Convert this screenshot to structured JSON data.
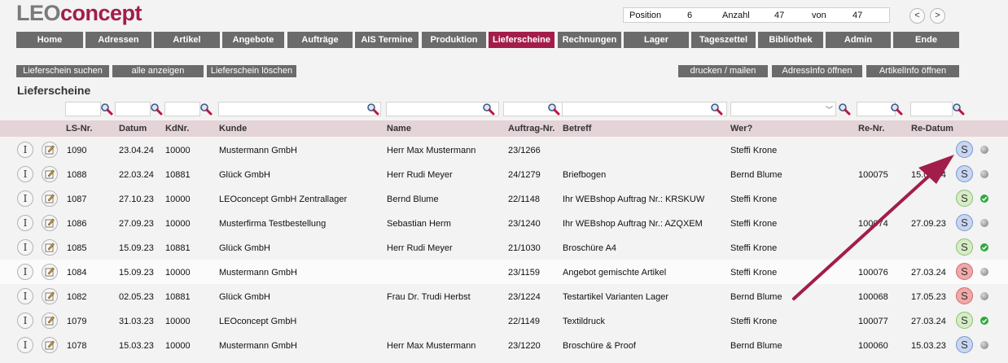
{
  "logo": {
    "part1": "LEO",
    "part2": "concept"
  },
  "position_bar": {
    "position_label": "Position",
    "position_value": "6",
    "count_label": "Anzahl",
    "count_value": "47",
    "of_label": "von",
    "of_value": "47",
    "prev": "<",
    "next": ">"
  },
  "nav": [
    "Home",
    "Adressen",
    "Artikel",
    "Angebote",
    "Aufträge",
    "AIS Termine",
    "Produktion",
    "Lieferscheine",
    "Rechnungen",
    "Lager",
    "Tageszettel",
    "Bibliothek",
    "Admin",
    "Ende"
  ],
  "nav_active": "Lieferscheine",
  "actions": {
    "search": "Lieferschein suchen",
    "show_all": "alle anzeigen",
    "delete": "Lieferschein löschen",
    "print": "drucken / mailen",
    "address_info": "AdressInfo öffnen",
    "article_info": "ArtikelInfo öffnen"
  },
  "page_title": "Lieferscheine",
  "columns": [
    "LS-Nr.",
    "Datum",
    "KdNr.",
    "Kunde",
    "Name",
    "Auftrag-Nr.",
    "Betreff",
    "Wer?",
    "Re-Nr.",
    "Re-Datum"
  ],
  "rows": [
    {
      "ls": "1090",
      "datum": "23.04.24",
      "kd": "10000",
      "kunde": "Mustermann GmbH",
      "name": "Herr Max Mustermann",
      "auftrag": "23/1266",
      "betreff": "",
      "wer": "Steffi Krone",
      "renr": "",
      "redatum": "",
      "status": "blue",
      "dot": "grey"
    },
    {
      "ls": "1088",
      "datum": "22.03.24",
      "kd": "10881",
      "kunde": "Glück GmbH",
      "name": "Herr Rudi Meyer",
      "auftrag": "24/1279",
      "betreff": "Briefbogen",
      "wer": "Bernd Blume",
      "renr": "100075",
      "redatum": "15.03.24",
      "status": "blue",
      "dot": "grey"
    },
    {
      "ls": "1087",
      "datum": "27.10.23",
      "kd": "10000",
      "kunde": "LEOconcept GmbH Zentrallager",
      "name": "Bernd Blume",
      "auftrag": "22/1148",
      "betreff": "Ihr WEBshop Auftrag Nr.: KRSKUW",
      "wer": "Steffi Krone",
      "renr": "",
      "redatum": "",
      "status": "green",
      "dot": "green"
    },
    {
      "ls": "1086",
      "datum": "27.09.23",
      "kd": "10000",
      "kunde": "Musterfirma Testbestellung",
      "name": "Sebastian Herm",
      "auftrag": "23/1240",
      "betreff": "Ihr WEBshop Auftrag Nr.: AZQXEM",
      "wer": "Steffi Krone",
      "renr": "100074",
      "redatum": "27.09.23",
      "status": "blue",
      "dot": "grey"
    },
    {
      "ls": "1085",
      "datum": "15.09.23",
      "kd": "10881",
      "kunde": "Glück GmbH",
      "name": "Herr Rudi Meyer",
      "auftrag": "21/1030",
      "betreff": "Broschüre A4",
      "wer": "Steffi Krone",
      "renr": "",
      "redatum": "",
      "status": "green",
      "dot": "green"
    },
    {
      "ls": "1084",
      "datum": "15.09.23",
      "kd": "10000",
      "kunde": "Mustermann GmbH",
      "name": "",
      "auftrag": "23/1159",
      "betreff": "Angebot gemischte Artikel",
      "wer": "Steffi Krone",
      "renr": "100076",
      "redatum": "27.03.24",
      "status": "red",
      "dot": "grey"
    },
    {
      "ls": "1082",
      "datum": "02.05.23",
      "kd": "10881",
      "kunde": "Glück GmbH",
      "name": "Frau Dr. Trudi Herbst",
      "auftrag": "23/1224",
      "betreff": "Testartikel Varianten Lager",
      "wer": "Bernd Blume",
      "renr": "100068",
      "redatum": "17.05.23",
      "status": "red",
      "dot": "grey"
    },
    {
      "ls": "1079",
      "datum": "31.03.23",
      "kd": "10000",
      "kunde": "LEOconcept GmbH",
      "name": "",
      "auftrag": "22/1149",
      "betreff": "Textildruck",
      "wer": "Steffi Krone",
      "renr": "100077",
      "redatum": "27.03.24",
      "status": "green",
      "dot": "green"
    },
    {
      "ls": "1078",
      "datum": "15.03.23",
      "kd": "10000",
      "kunde": "Mustermann GmbH",
      "name": "Herr Max Mustermann",
      "auftrag": "23/1220",
      "betreff": "Broschüre & Proof",
      "wer": "Bernd Blume",
      "renr": "100060",
      "redatum": "15.03.23",
      "status": "blue",
      "dot": "grey"
    }
  ],
  "status_letter": "S",
  "info_letter": "I",
  "colors": {
    "accent": "#a31d4a",
    "nav": "#6b6b6b",
    "header": "#e4d3d7"
  }
}
